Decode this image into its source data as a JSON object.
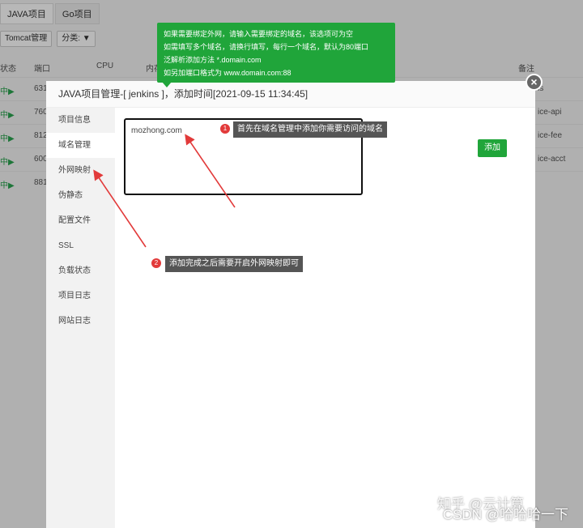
{
  "background": {
    "tabs": [
      "JAVA项目",
      "Go项目"
    ],
    "toolbar": {
      "tomcat_label": "Tomcat管理",
      "category_label": "分类: ▼"
    },
    "table_headers": {
      "status": "状态",
      "port": "端口",
      "cpu": "CPU",
      "mem": "内存",
      "note": "备注"
    },
    "rows": [
      {
        "status": "中▶",
        "port": "631",
        "note": "ls"
      },
      {
        "status": "中▶",
        "port": "760",
        "note": "ice-api"
      },
      {
        "status": "中▶",
        "port": "812",
        "note": "ice-fee"
      },
      {
        "status": "中▶",
        "port": "600",
        "note": "ice-acct"
      },
      {
        "status": "中▶",
        "port": "881",
        "note": ""
      }
    ]
  },
  "modal": {
    "title": "JAVA项目管理-[ jenkins ]，添加时间[2021-09-15 11:34:45]",
    "close_icon": "×",
    "sidebar": [
      "项目信息",
      "域名管理",
      "外网映射",
      "伪静态",
      "配置文件",
      "SSL",
      "负载状态",
      "项目日志",
      "网站日志"
    ],
    "active_item": "域名管理",
    "domain_value": "mozhong.com",
    "add_button": "添加"
  },
  "tooltip": {
    "lines": [
      "如果需要绑定外网，请输入需要绑定的域名，该选项可为空",
      "如需填写多个域名，请换行填写，每行一个域名，默认为80端口",
      "泛解析添加方法 *.domain.com",
      "如另加端口格式为 www.domain.com:88"
    ]
  },
  "annotations": [
    {
      "num": "1",
      "text": "首先在域名管理中添加你需要访问的域名"
    },
    {
      "num": "2",
      "text": "添加完成之后需要开启外网映射即可"
    }
  ],
  "watermarks": {
    "zhihu": "知乎 @云计算",
    "csdn": "CSDN @哈哈哈一下"
  },
  "colors": {
    "accent": "#20a53a",
    "annotation_bg": "#555555",
    "arrow": "#e23a3a"
  }
}
